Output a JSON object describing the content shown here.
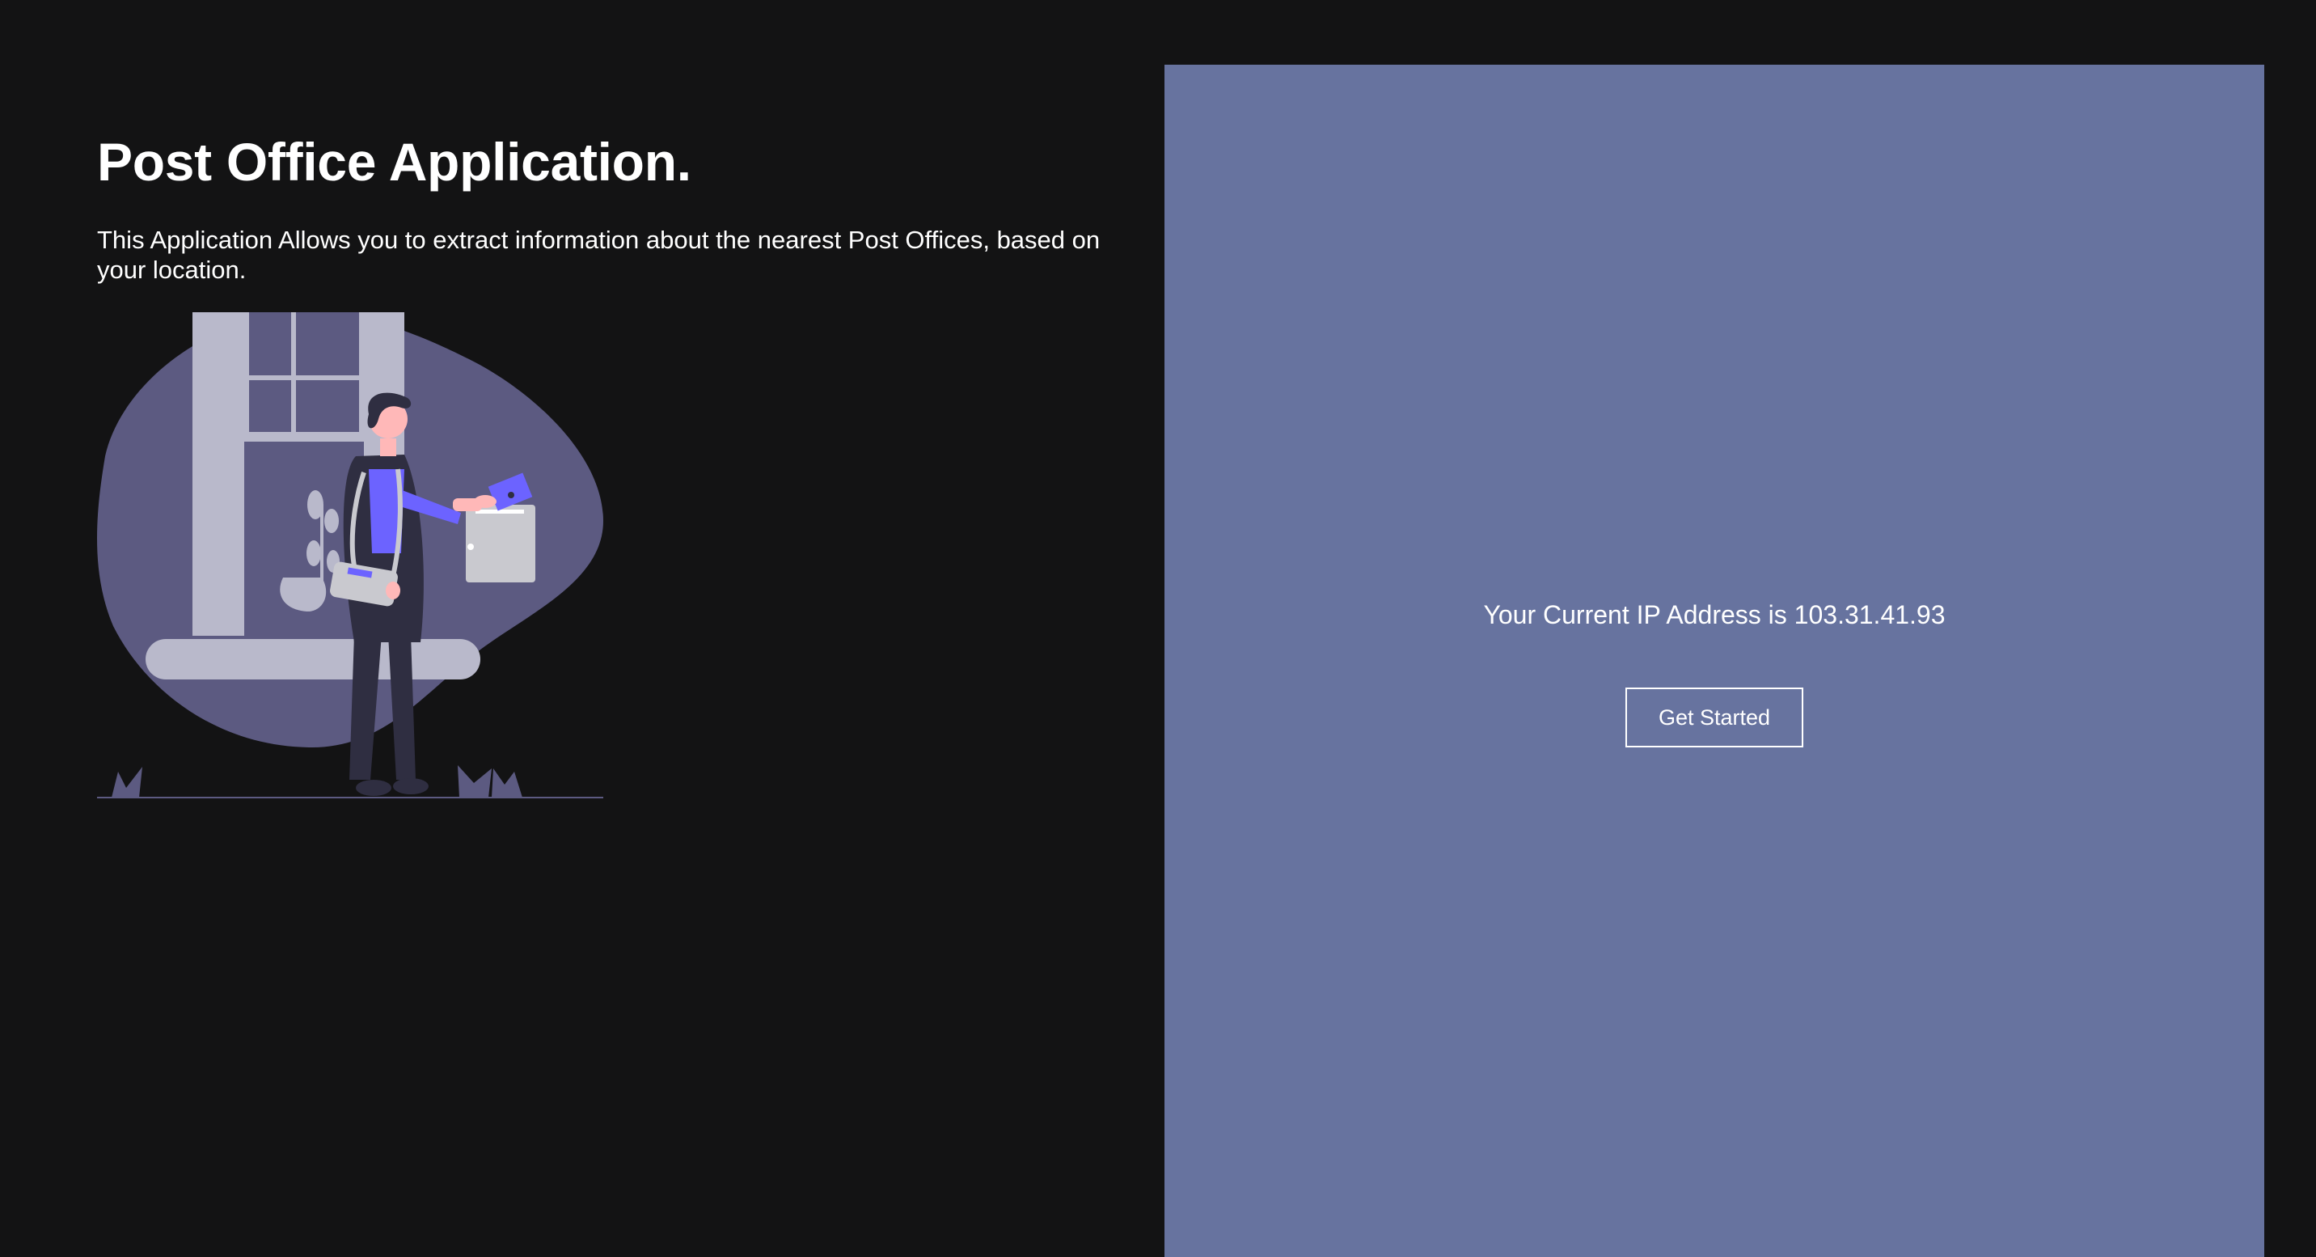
{
  "hero": {
    "title": "Post Office Application.",
    "description": "This Application Allows you to extract information about the nearest Post Offices, based on your location.",
    "illustration_icon": "mail-delivery-person-illustration"
  },
  "panel": {
    "ip_label": "Your Current IP Address is",
    "ip_address": "103.31.41.93",
    "button_label": "Get Started"
  },
  "colors": {
    "background": "#131314",
    "panel": "#67739f",
    "text": "#ffffff",
    "accent": "#6c63ff"
  }
}
